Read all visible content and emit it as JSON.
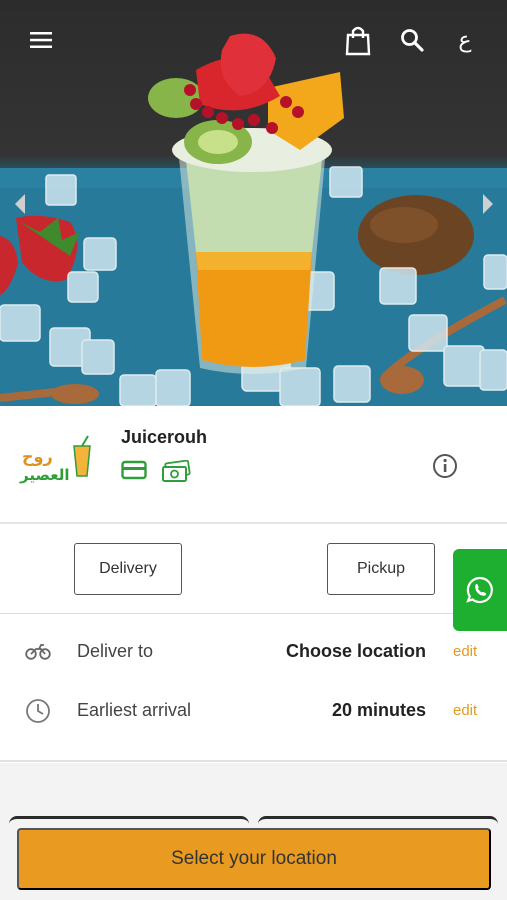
{
  "header": {
    "menu_icon": "menu-icon",
    "cart_icon": "shopping-bag-icon",
    "search_icon": "search-icon",
    "language_label": "ع"
  },
  "hero": {
    "description_icon": "juice-product-image",
    "prev_icon": "chevron-left-icon",
    "next_icon": "chevron-right-icon"
  },
  "store": {
    "name": "Juicerouh",
    "logo_text_ar_line1": "روح",
    "logo_text_ar_line2": "العصير",
    "payment_icons": [
      "credit-card-icon",
      "cash-icon"
    ],
    "info_icon": "info-icon",
    "brand_green": "#2f9e3a"
  },
  "order_type": {
    "delivery_label": "Delivery",
    "pickup_label": "Pickup",
    "whatsapp_icon": "whatsapp-icon",
    "whatsapp_color": "#1eae30"
  },
  "details": {
    "rows": [
      {
        "icon": "motorbike-icon",
        "label": "Deliver to",
        "value": "Choose location",
        "edit": "edit"
      },
      {
        "icon": "clock-icon",
        "label": "Earliest arrival",
        "value": "20 minutes",
        "edit": "edit"
      }
    ],
    "accent": "#e39a23"
  },
  "footer": {
    "cta_label": "Select your location",
    "cta_color": "#e99b21"
  }
}
